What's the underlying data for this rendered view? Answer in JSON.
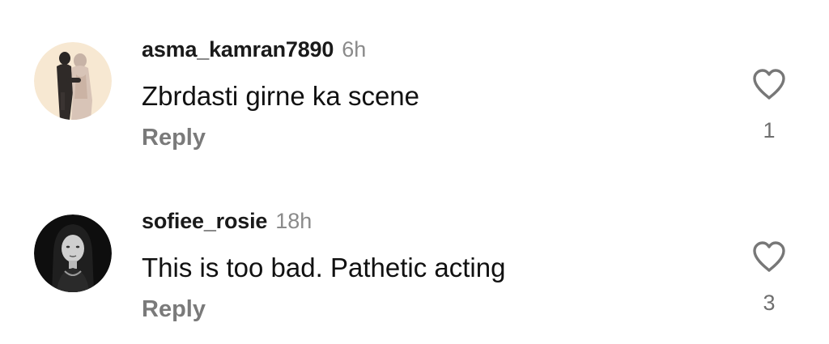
{
  "comments": [
    {
      "username": "asma_kamran7890",
      "time": "6h",
      "text": "Zbrdasti girne ka scene",
      "reply_label": "Reply",
      "likes": "1",
      "avatar_style": "couple-illustration"
    },
    {
      "username": "sofiee_rosie",
      "time": "18h",
      "text": "This is too bad. Pathetic acting",
      "reply_label": "Reply",
      "likes": "3",
      "avatar_style": "dark-portrait"
    }
  ],
  "colors": {
    "username": "#1a1a1a",
    "time": "#8a8a8a",
    "reply": "#7a7a7a",
    "heart": "#777777"
  },
  "icons": [
    "heart-outline-icon"
  ]
}
